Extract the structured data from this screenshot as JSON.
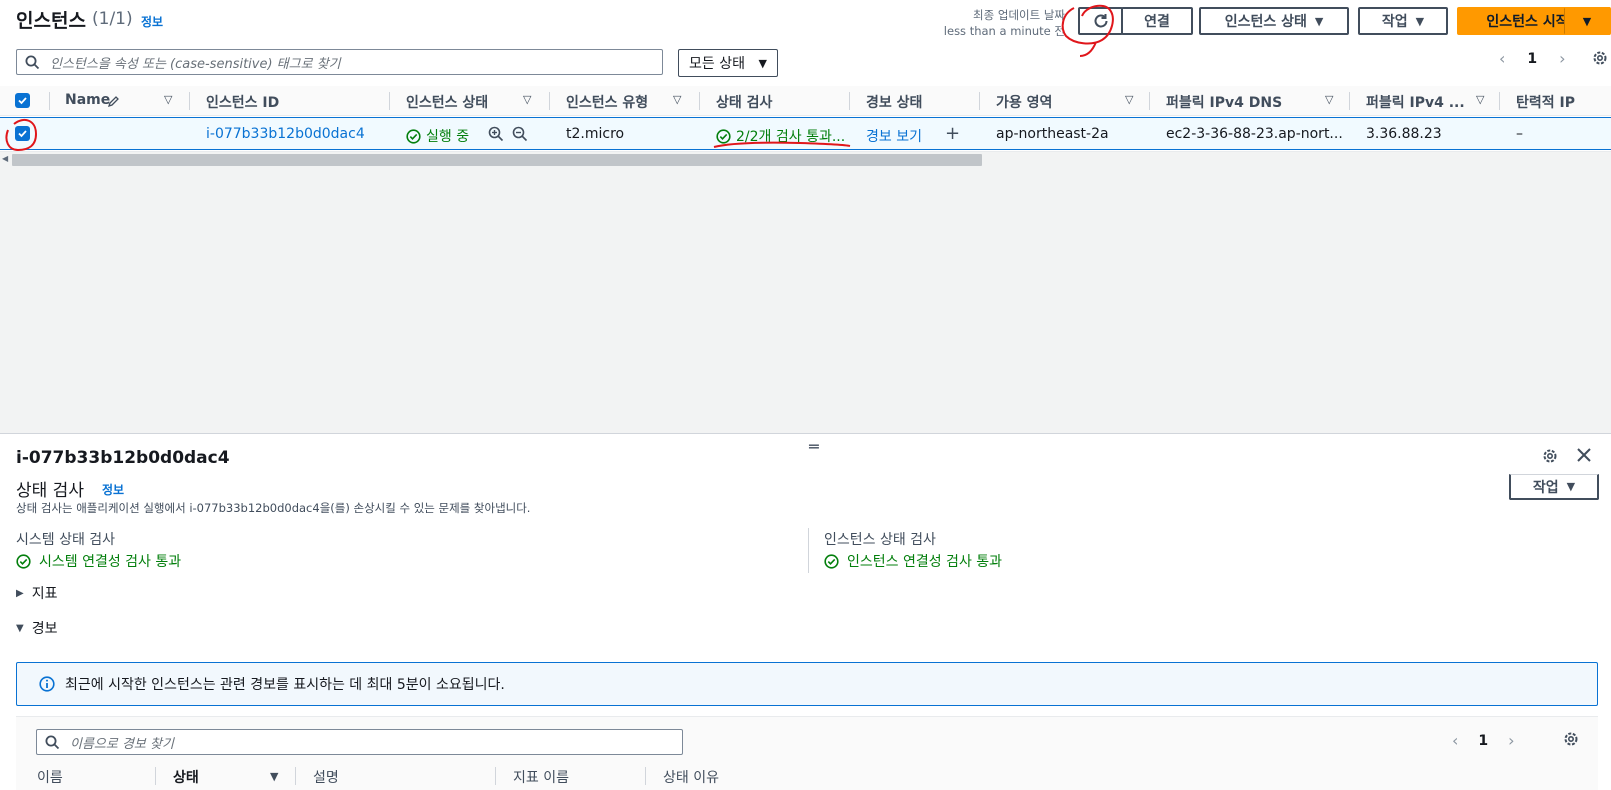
{
  "header": {
    "title": "인스턴스",
    "count": "(1/1)",
    "info": "정보",
    "last_updated_label": "최종 업데이트 날짜",
    "last_updated_value": "less than a minute 전",
    "connect_label": "연결",
    "instance_state_label": "인스턴스 상태",
    "actions_label": "작업",
    "launch_label": "인스턴스 시작"
  },
  "filter": {
    "search_placeholder": "인스턴스을 속성 또는 (case-sensitive) 태그로 찾기",
    "state_select": "모든 상태",
    "page": "1"
  },
  "table": {
    "columns": [
      "Name",
      "인스턴스 ID",
      "인스턴스 상태",
      "인스턴스 유형",
      "상태 검사",
      "경보 상태",
      "가용 영역",
      "퍼블릭 IPv4 DNS",
      "퍼블릭 IPv4 ...",
      "탄력적 IP"
    ],
    "row": {
      "name": "",
      "instance_id": "i-077b33b12b0d0dac4",
      "state": "실행 중",
      "type": "t2.micro",
      "status_check": "2/2개 검사 통과...",
      "alarm": "경보 보기",
      "alarm_add": "+",
      "az": "ap-northeast-2a",
      "dns": "ec2-3-36-88-23.ap-nort...",
      "ipv4": "3.36.88.23",
      "eip": "–"
    }
  },
  "detail": {
    "instance_id": "i-077b33b12b0d0dac4",
    "section_title": "상태 검사",
    "section_info": "정보",
    "actions_label": "작업",
    "description": "상태 검사는 애플리케이션 실행에서 i-077b33b12b0d0dac4을(를) 손상시킬 수 있는 문제를 찾아냅니다.",
    "system_check_label": "시스템 상태 검사",
    "system_check_value": "시스템 연결성 검사 통과",
    "instance_check_label": "인스턴스 상태 검사",
    "instance_check_value": "인스턴스 연결성 검사 통과",
    "metrics_label": "지표",
    "alarms_label": "경보",
    "alert_text": "최근에 시작한 인스턴스는 관련 경보를 표시하는 데 최대 5분이 소요됩니다.",
    "alarm_search_placeholder": "이름으로 경보 찾기",
    "alarm_page": "1",
    "alarm_columns": [
      "이름",
      "상태",
      "설명",
      "지표 이름",
      "상태 이유"
    ]
  },
  "colors": {
    "link": "#0972d3",
    "success": "#037f0c",
    "primary_button": "#ff9900",
    "annotation": "#e0161b"
  }
}
